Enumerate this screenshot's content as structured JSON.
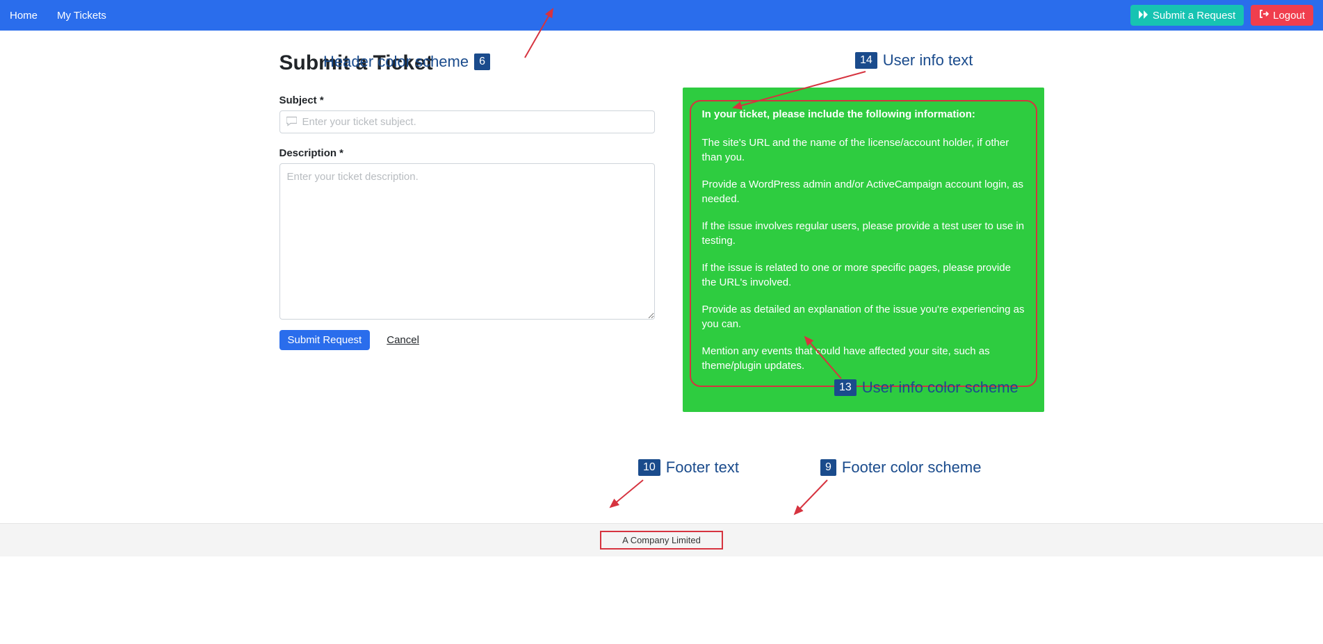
{
  "header": {
    "nav": {
      "home": "Home",
      "mytickets": "My Tickets"
    },
    "submit_btn": "Submit a Request",
    "logout_btn": "Logout"
  },
  "page": {
    "title": "Submit a Ticket"
  },
  "form": {
    "subject_label": "Subject *",
    "subject_placeholder": "Enter your ticket subject.",
    "description_label": "Description *",
    "description_placeholder": "Enter your ticket description.",
    "submit_label": "Submit Request",
    "cancel_label": "Cancel"
  },
  "info": {
    "title": "In your ticket, please include the following information:",
    "items": [
      "The site's URL and the name of the license/account holder, if other than you.",
      "Provide a WordPress admin and/or ActiveCampaign account login, as needed.",
      "If the issue involves regular users, please provide a test user to use in testing.",
      "If the issue is related to one or more specific pages, please provide the URL's involved.",
      "Provide as detailed an explanation of the issue you're experiencing as you can.",
      "Mention any events that could have affected your site, such as theme/plugin updates."
    ]
  },
  "footer": {
    "text": "A Company Limited"
  },
  "annotations": {
    "a6": {
      "num": "6",
      "label": "Header color scheme"
    },
    "a14": {
      "num": "14",
      "label": "User info text"
    },
    "a13": {
      "num": "13",
      "label": "User info color scheme"
    },
    "a10": {
      "num": "10",
      "label": "Footer text"
    },
    "a9": {
      "num": "9",
      "label": "Footer color scheme"
    }
  }
}
